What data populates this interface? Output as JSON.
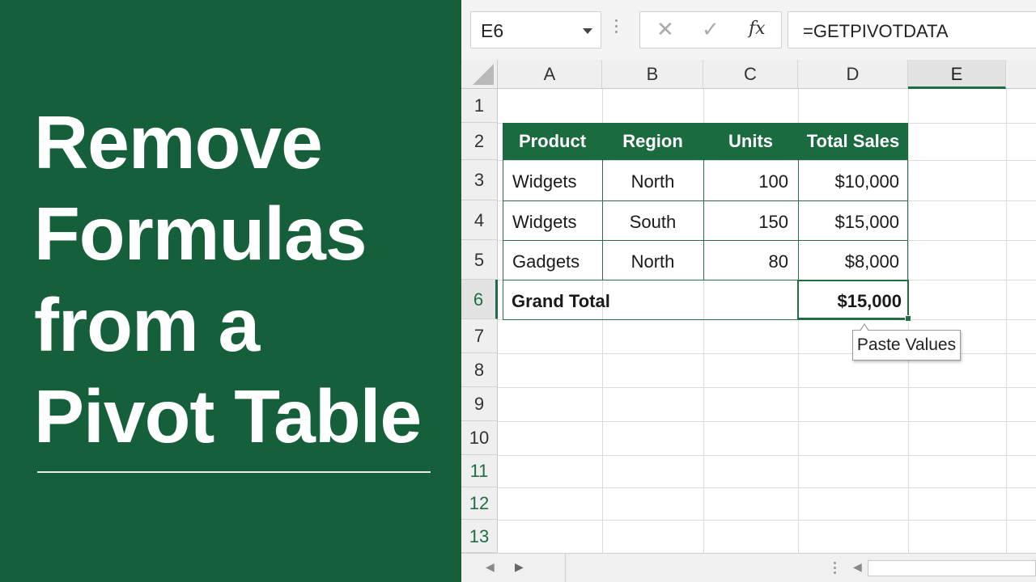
{
  "title": {
    "lines": [
      "Remove",
      "Formulas",
      "from a",
      "Pivot Table"
    ]
  },
  "formula_bar": {
    "name_box": "E6",
    "cancel_icon": "✕",
    "enter_icon": "✓",
    "fx_label": "fx",
    "formula": "=GETPIVOTDATA"
  },
  "columns": [
    "A",
    "B",
    "C",
    "D",
    "E"
  ],
  "rows": [
    "1",
    "2",
    "3",
    "4",
    "5",
    "6",
    "7",
    "8",
    "9",
    "10",
    "11",
    "12",
    "13"
  ],
  "table": {
    "headers": [
      "Product",
      "Region",
      "Units",
      "Total Sales"
    ],
    "rows": [
      [
        "Widgets",
        "North",
        "100",
        "$10,000"
      ],
      [
        "Widgets",
        "South",
        "150",
        "$15,000"
      ],
      [
        "Gadgets",
        "North",
        "80",
        "$8,000"
      ]
    ],
    "total_label": "Grand Total",
    "total_value": "$15,000"
  },
  "tooltip": "Paste Values",
  "colors": {
    "panel": "#155f3b",
    "table_header": "#1b6b40",
    "selection": "#1f6e43"
  },
  "active_cell": "E6",
  "active_column": "E",
  "active_row": "6"
}
